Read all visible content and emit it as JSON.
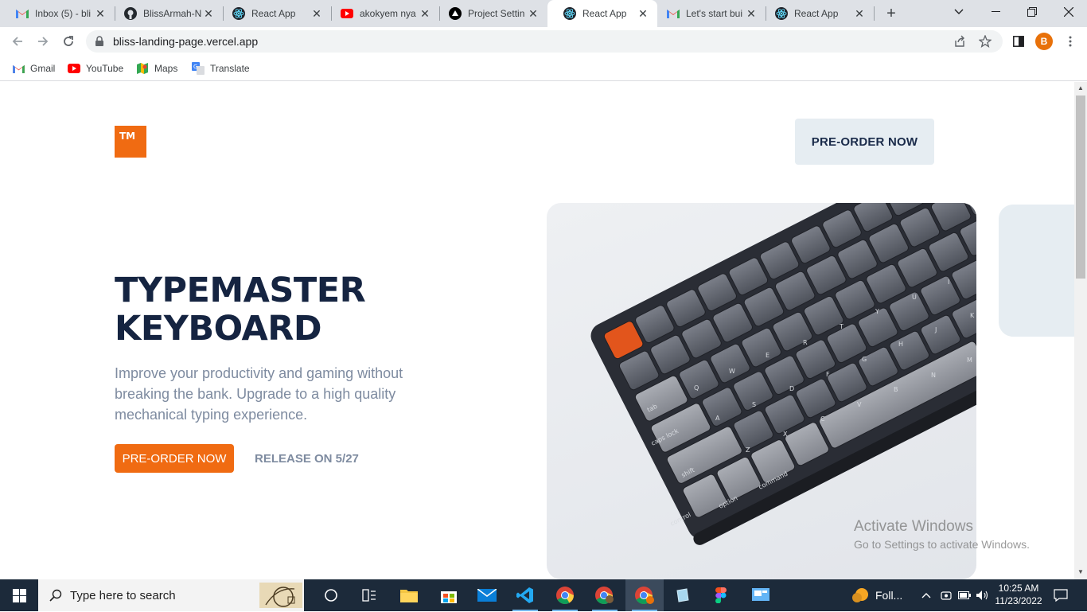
{
  "browser": {
    "tabs": [
      {
        "title": "Inbox (5) - bli",
        "icon": "gmail-icon"
      },
      {
        "title": "BlissArmah-N",
        "icon": "github-icon"
      },
      {
        "title": "React App",
        "icon": "react-icon"
      },
      {
        "title": "akokyem nya",
        "icon": "youtube-icon"
      },
      {
        "title": "Project Settin",
        "icon": "vercel-icon"
      },
      {
        "title": "React App",
        "icon": "react-icon",
        "active": true
      },
      {
        "title": "Let's start bui",
        "icon": "gmail-icon"
      },
      {
        "title": "React App",
        "icon": "react-icon"
      }
    ],
    "url": "bliss-landing-page.vercel.app",
    "profile_initial": "B",
    "bookmarks": [
      {
        "label": "Gmail",
        "icon": "gmail-icon"
      },
      {
        "label": "YouTube",
        "icon": "youtube-icon"
      },
      {
        "label": "Maps",
        "icon": "maps-icon"
      },
      {
        "label": "Translate",
        "icon": "translate-icon"
      }
    ]
  },
  "page": {
    "logo_text": "TM",
    "nav_cta": "PRE-ORDER NOW",
    "headline_line1": "TYPEMASTER",
    "headline_line2": "KEYBOARD",
    "subtitle": "Improve your productivity and gaming without breaking the bank. Upgrade to a high quality mechanical typing experience.",
    "cta": "PRE-ORDER NOW",
    "release": "RELEASE ON 5/27",
    "keyboard_keys": [
      "tab",
      "caps lock",
      "shift",
      "control",
      "option",
      "command",
      "Q",
      "W",
      "E",
      "R",
      "T",
      "Y",
      "U",
      "I",
      "A",
      "S",
      "D",
      "F",
      "G",
      "H",
      "J",
      "K",
      "Z",
      "X",
      "C",
      "V",
      "B",
      "N",
      "M"
    ],
    "accent_color": "#f06b12",
    "heading_color": "#152441"
  },
  "watermark": {
    "line1": "Activate Windows",
    "line2": "Go to Settings to activate Windows."
  },
  "taskbar": {
    "search_placeholder": "Type here to search",
    "weather_text": "Foll...",
    "time": "10:25 AM",
    "date": "11/23/2022"
  }
}
